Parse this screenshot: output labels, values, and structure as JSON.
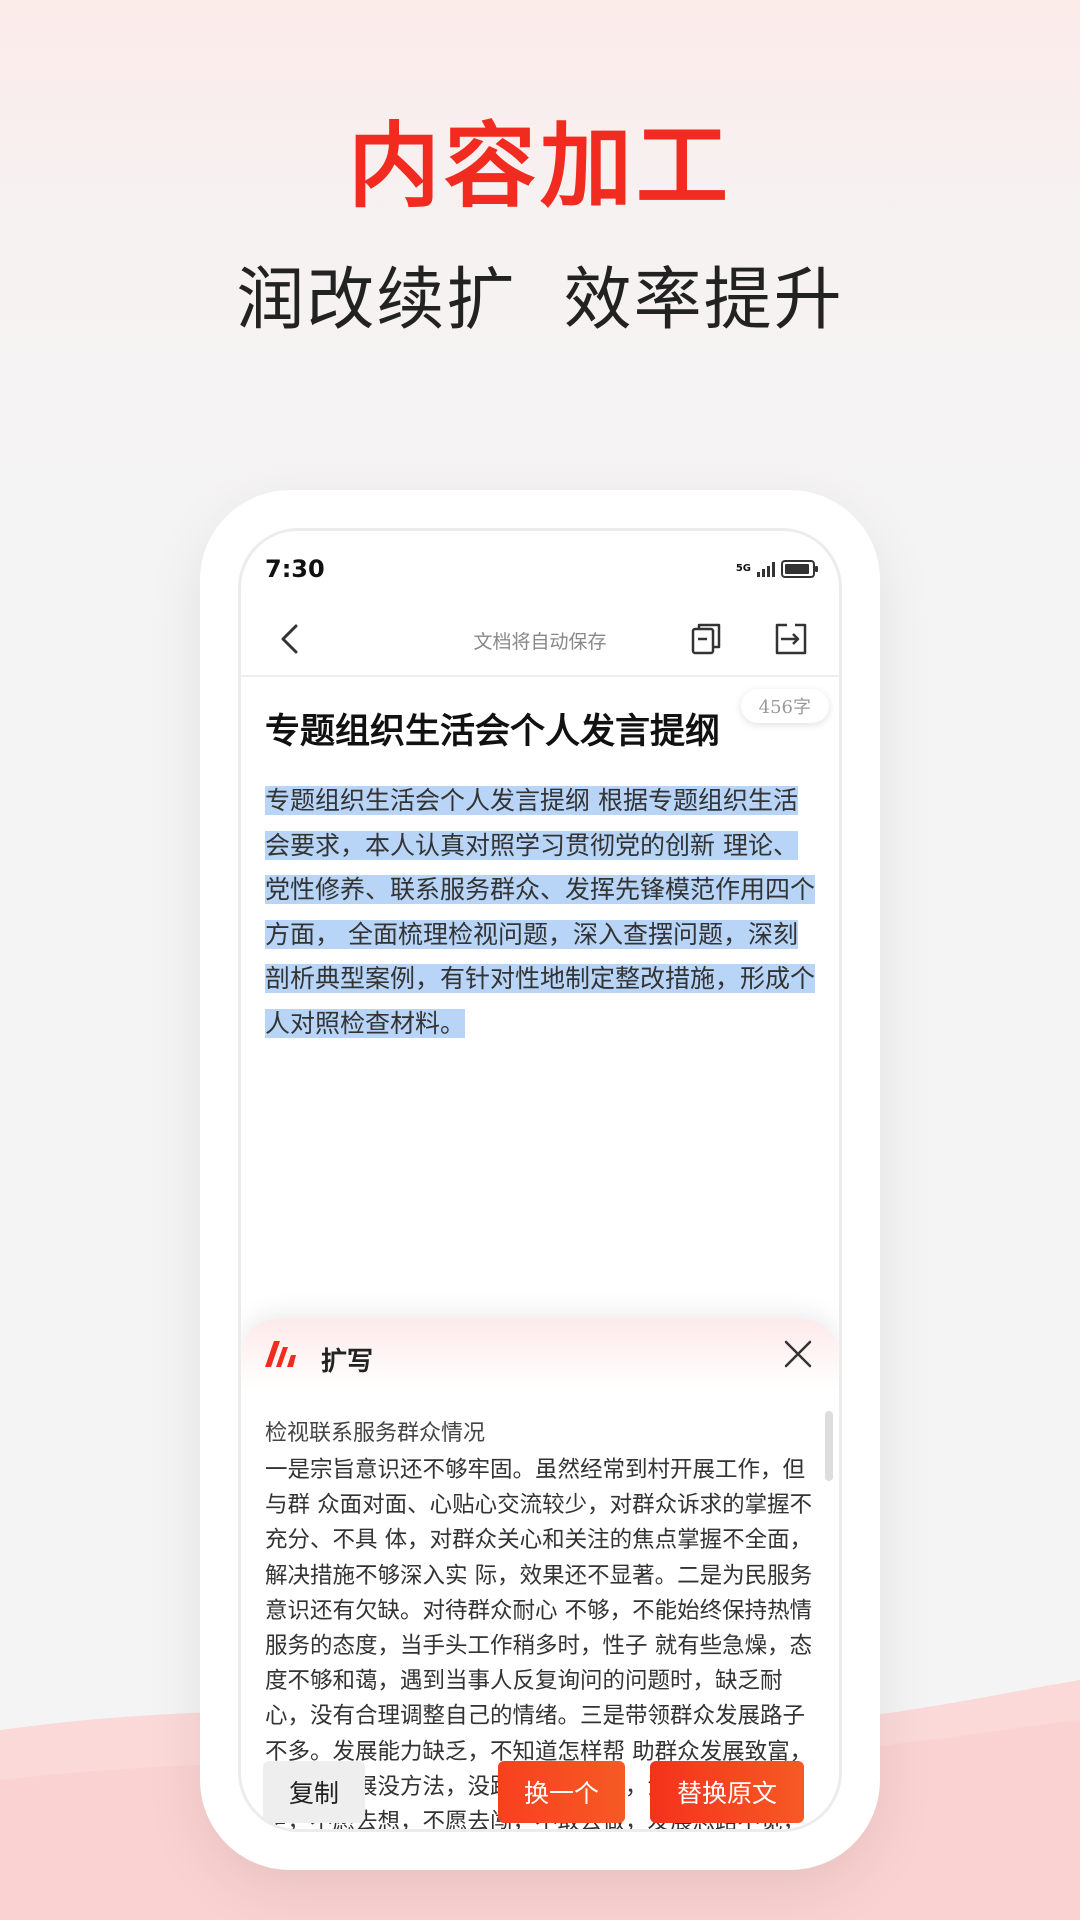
{
  "hero": {
    "title": "内容加工",
    "subtitle": "润改续扩  效率提升"
  },
  "status_bar": {
    "time": "7:30",
    "network": "5G"
  },
  "top_bar": {
    "autosave_text": "文档将自动保存"
  },
  "document": {
    "word_count": "456字",
    "title": "专题组织生活会个人发言提纲",
    "selected_text": "专题组织生活会个人发言提纲 根据专题组织生活会要求，本人认真对照学习贯彻党的创新 理论、党性修养、联系服务群众、发挥先锋模范作用四个方面， 全面梳理检视问题，深入查摆问题，深刻剖析典型案例，有针对性地制定整改措施，形成个人对照检查材料。"
  },
  "expand_panel": {
    "title": "扩写",
    "result_subtitle": "检视联系服务群众情况",
    "result_text": "一是宗旨意识还不够牢固。虽然经常到村开展工作，但与群 众面对面、心贴心交流较少，对群众诉求的掌握不充分、不具 体，对群众关心和关注的焦点掌握不全面，解决措施不够深入实 际，效果还不显著。二是为民服务意识还有欠缺。对待群众耐心 不够，不能始终保持热情服务的态度，当手头工作稍多时，性子 就有些急燥，态度不够和蔼，遇到当事人反复询问的问题时，缺乏耐心，没有合理调整自己的情绪。三是带领群众发展路子不多。发展能力缺乏，不知道怎样帮 助群众发展致富，总感觉发展没方法，没路子，没资金，没人力，创新不足，不愿去想，不愿去闯，不敢去做，发展思路不宽，工作推进不够有力。",
    "buttons": {
      "copy": "复制",
      "another": "换一个",
      "replace": "替换原文"
    }
  },
  "colors": {
    "accent": "#f12b1f",
    "selection": "#b8d5f7",
    "button_gradient_start": "#f4321c",
    "button_gradient_end": "#f65a24"
  }
}
